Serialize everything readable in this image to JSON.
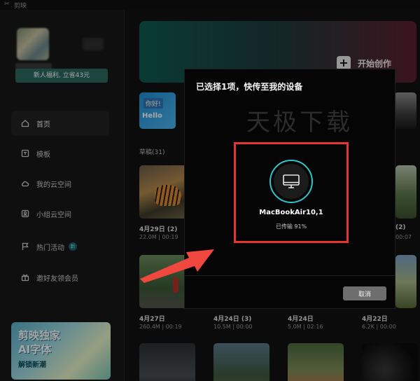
{
  "titlebar": {
    "logo": "✂",
    "app_name": "剪映"
  },
  "user": {
    "welfare_badge": "新人福利, 立省43元"
  },
  "sidebar": {
    "items": [
      {
        "label": "首页",
        "icon": "home-icon",
        "active": true
      },
      {
        "label": "模板",
        "icon": "template-icon"
      },
      {
        "label": "我的云空间",
        "icon": "cloud-icon"
      },
      {
        "label": "小组云空间",
        "icon": "group-cloud-icon"
      },
      {
        "label": "热门活动",
        "icon": "flag-icon",
        "badge": "新"
      },
      {
        "label": "邀好友领会员",
        "icon": "gift-icon"
      }
    ],
    "promo": {
      "line1": "剪映独家",
      "line2": "AI字体",
      "line3": "解锁新潮"
    }
  },
  "main": {
    "create_label": "开始创作",
    "template_hello": {
      "greeting": "你好!",
      "word": "Hello"
    },
    "drafts_title": "草稿(31)",
    "cards_row1": [
      {
        "date": "4月29日 (2)",
        "meta": "22.0M | 00:19"
      },
      {
        "date": "(2)",
        "meta": "00:07"
      }
    ],
    "cards_row2": [
      {
        "date": "4月27日",
        "meta": "260.4M | 00:19"
      },
      {
        "date": "4月24日 (3)",
        "meta": "10.5M | 00:00"
      },
      {
        "date": "4月24日",
        "meta": "5.0M | 02:16"
      },
      {
        "date": "4月22日",
        "meta": "6.2K | 00:00"
      }
    ]
  },
  "modal": {
    "title": "已选择1项，快传至我的设备",
    "watermark": "天极下载",
    "device_name": "MacBookAir10,1",
    "status": "已传输 91%",
    "progress": 0.91,
    "cancel_label": "取消"
  },
  "colors": {
    "accent": "#2ec5cc",
    "highlight": "#e53434",
    "arrow": "#f0483e"
  }
}
